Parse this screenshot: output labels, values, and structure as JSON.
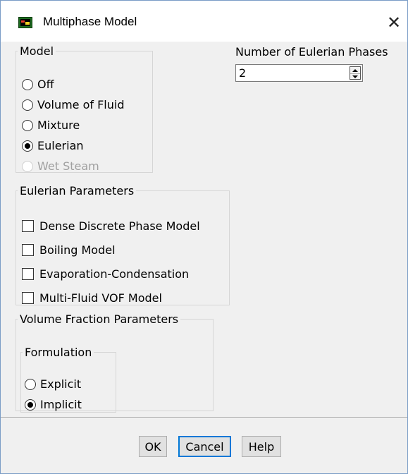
{
  "window": {
    "title": "Multiphase Model",
    "close_glyph": "✕",
    "icon": "fluent-app-icon"
  },
  "model": {
    "legend": "Model",
    "options": [
      {
        "label": "Off",
        "selected": false,
        "enabled": true
      },
      {
        "label": "Volume of Fluid",
        "selected": false,
        "enabled": true
      },
      {
        "label": "Mixture",
        "selected": false,
        "enabled": true
      },
      {
        "label": "Eulerian",
        "selected": true,
        "enabled": true
      },
      {
        "label": "Wet Steam",
        "selected": false,
        "enabled": false
      }
    ]
  },
  "phases": {
    "label": "Number of Eulerian Phases",
    "value": "2"
  },
  "eulerian_parameters": {
    "legend": "Eulerian Parameters",
    "checkboxes": [
      {
        "label": "Dense Discrete Phase Model",
        "checked": false
      },
      {
        "label": "Boiling Model",
        "checked": false
      },
      {
        "label": "Evaporation-Condensation",
        "checked": false
      },
      {
        "label": "Multi-Fluid VOF Model",
        "checked": false
      }
    ]
  },
  "volume_fraction": {
    "legend": "Volume Fraction Parameters",
    "formulation": {
      "legend": "Formulation",
      "options": [
        {
          "label": "Explicit",
          "selected": false
        },
        {
          "label": "Implicit",
          "selected": true
        }
      ]
    }
  },
  "buttons": {
    "ok": "OK",
    "cancel": "Cancel",
    "help": "Help"
  },
  "colors": {
    "default_button_border": "#0078d7",
    "dialog_background": "#f0f0f0",
    "disabled_text": "#a0a0a0"
  }
}
